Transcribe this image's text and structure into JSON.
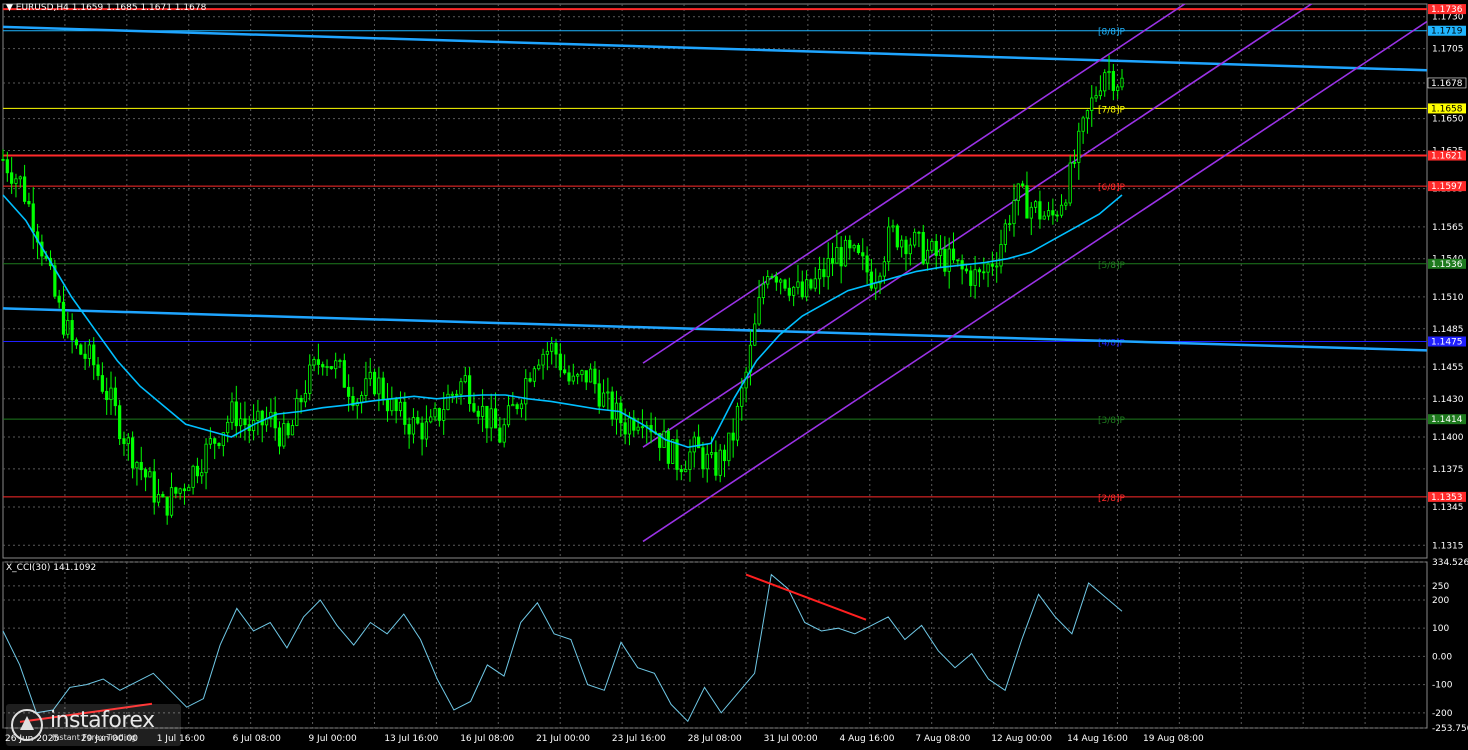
{
  "header": {
    "text": "▼ EURUSD,H4  1.1659 1.1685 1.1671 1.1678"
  },
  "cci_header": {
    "text": "X_CCI(30) 141.1092"
  },
  "logo": {
    "name": "instaforex",
    "tagline": "Instant Forex Trading"
  },
  "colors": {
    "candle": "#00ff00",
    "ma": "#00bfff",
    "trendline": "#1fa5ff",
    "channel": "#9a32e6",
    "cci": "#6fc8e6",
    "divergence": "#ff2020",
    "grid": "#5a5a5a",
    "axis_text": "#ffffff"
  },
  "chart_data": {
    "type": "candlestick",
    "symbol": "EURUSD",
    "timeframe": "H4",
    "ylim": [
      1.1305,
      1.174
    ],
    "grid": true,
    "y_ticks": [
      "1.1730",
      "1.1705",
      "1.1678",
      "1.1650",
      "1.1625",
      "1.1595",
      "1.1565",
      "1.1540",
      "1.1510",
      "1.1485",
      "1.1455",
      "1.1430",
      "1.1400",
      "1.1375",
      "1.1345",
      "1.1315"
    ],
    "x_ticks": [
      "26 Jun 2025",
      "29 Jun 00:00",
      "1 Jul 16:00",
      "6 Jul 08:00",
      "9 Jul 00:00",
      "13 Jul 16:00",
      "16 Jul 08:00",
      "21 Jul 00:00",
      "23 Jul 16:00",
      "28 Jul 08:00",
      "31 Jul 00:00",
      "4 Aug 16:00",
      "7 Aug 08:00",
      "12 Aug 00:00",
      "14 Aug 16:00",
      "19 Aug 08:00"
    ],
    "close_path": [
      1.1618,
      1.16,
      1.156,
      1.1505,
      1.147,
      1.146,
      1.143,
      1.1395,
      1.137,
      1.1345,
      1.136,
      1.138,
      1.14,
      1.142,
      1.1405,
      1.1415,
      1.1395,
      1.144,
      1.1465,
      1.145,
      1.143,
      1.1445,
      1.142,
      1.141,
      1.1405,
      1.143,
      1.1445,
      1.142,
      1.14,
      1.143,
      1.1465,
      1.147,
      1.144,
      1.145,
      1.1425,
      1.141,
      1.142,
      1.14,
      1.138,
      1.139,
      1.1375,
      1.1395,
      1.146,
      1.1535,
      1.1525,
      1.151,
      1.1525,
      1.1545,
      1.154,
      1.1525,
      1.156,
      1.1555,
      1.1545,
      1.154,
      1.153,
      1.1525,
      1.1545,
      1.159,
      1.158,
      1.157,
      1.16,
      1.165,
      1.169,
      1.1678
    ],
    "ma_path": [
      1.159,
      1.157,
      1.154,
      1.151,
      1.1485,
      1.146,
      1.144,
      1.1425,
      1.141,
      1.1405,
      1.14,
      1.141,
      1.1418,
      1.142,
      1.1423,
      1.1425,
      1.1428,
      1.143,
      1.1432,
      1.143,
      1.1432,
      1.1433,
      1.1433,
      1.143,
      1.1428,
      1.1425,
      1.1422,
      1.142,
      1.141,
      1.1398,
      1.1392,
      1.1395,
      1.143,
      1.146,
      1.148,
      1.1495,
      1.1505,
      1.1515,
      1.152,
      1.1525,
      1.153,
      1.1533,
      1.1535,
      1.1537,
      1.154,
      1.1545,
      1.1555,
      1.1565,
      1.1575,
      1.159
    ],
    "trendlines": [
      {
        "name": "upper",
        "from": 1.1722,
        "to": 1.1688
      },
      {
        "name": "lower",
        "from": 1.1501,
        "to": 1.1468
      }
    ],
    "channel": {
      "start_low": 1.1318,
      "start_high": 1.1458,
      "mid_start": 1.1392
    },
    "levels": [
      {
        "value": "1.1736",
        "color": "#ff2a2a",
        "label": "",
        "bold": true
      },
      {
        "value": "1.1719",
        "color": "#1fb5ff",
        "label": "[8/8]P"
      },
      {
        "value": "1.1658",
        "color": "#ffff00",
        "label": "[7/8]P"
      },
      {
        "value": "1.1621",
        "color": "#ff2a2a",
        "label": "",
        "bold": true
      },
      {
        "value": "1.1597",
        "color": "#ff2a2a",
        "label": "[6/8]P"
      },
      {
        "value": "1.1536",
        "color": "#1e7a1e",
        "label": "[5/8]P"
      },
      {
        "value": "1.1475",
        "color": "#2020ff",
        "label": "[4/8]P"
      },
      {
        "value": "1.1414",
        "color": "#1e7a1e",
        "label": "[3/8]P"
      },
      {
        "value": "1.1353",
        "color": "#ff2a2a",
        "label": "[2/8]P"
      }
    ],
    "cci": {
      "name": "X_CCI(30)",
      "ylim": [
        -253.75,
        334.5265
      ],
      "y_ticks": [
        "334.5265",
        "250",
        "200",
        "100",
        "0.00",
        "-100",
        "-200",
        "-253.750"
      ],
      "values": [
        90,
        -30,
        -200,
        -190,
        -110,
        -100,
        -80,
        -120,
        -90,
        -60,
        -120,
        -180,
        -150,
        40,
        170,
        90,
        120,
        30,
        140,
        200,
        110,
        40,
        120,
        80,
        150,
        60,
        -80,
        -190,
        -160,
        -30,
        -70,
        120,
        190,
        80,
        60,
        -100,
        -120,
        50,
        -40,
        -60,
        -170,
        -230,
        -110,
        -200,
        -130,
        -60,
        290,
        240,
        120,
        90,
        100,
        80,
        110,
        140,
        60,
        110,
        20,
        -40,
        10,
        -80,
        -120,
        60,
        220,
        140,
        80,
        260,
        210,
        160
      ]
    },
    "divergence_lines": [
      {
        "from": 290,
        "to": 130
      },
      {
        "from": -232,
        "to": -168
      }
    ]
  }
}
